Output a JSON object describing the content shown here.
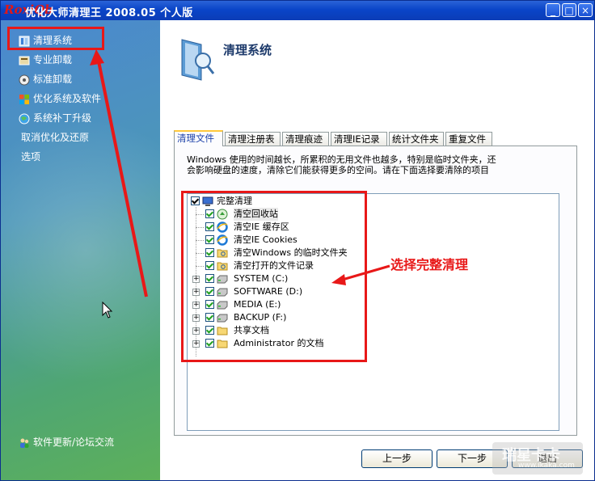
{
  "window": {
    "logo_text": "RoxiQb",
    "title": "优化大师清理王 2008.05 个人版",
    "min_label": "_",
    "max_label": "□",
    "close_label": "×"
  },
  "sidebar": {
    "items": [
      {
        "label": "清理系统",
        "icon": "broom-icon"
      },
      {
        "label": "专业卸载",
        "icon": "uninstall-icon"
      },
      {
        "label": "标准卸载",
        "icon": "cd-icon"
      },
      {
        "label": "优化系统及软件",
        "icon": "windows-flag-icon"
      },
      {
        "label": "系统补丁升级",
        "icon": "globe-icon"
      }
    ],
    "plain_items": [
      "取消优化及还原",
      "选项"
    ],
    "footer_label": "软件更新/论坛交流"
  },
  "main": {
    "title": "清理系统",
    "tabs": [
      "清理文件",
      "清理注册表",
      "清理痕迹",
      "清理IE记录",
      "统计文件夹",
      "重复文件"
    ],
    "description_line1": "Windows 使用的时间越长，所累积的无用文件也越多，特别是临时文件夹，还",
    "description_line2": "会影响硬盘的速度，清除它们能获得更多的空间。请在下面选择要清除的项目",
    "tree": {
      "root": "完整清理",
      "children": [
        {
          "label": "清空回收站",
          "icon": "recycle-bin-icon"
        },
        {
          "label": "清空IE 缓存区",
          "icon": "ie-icon"
        },
        {
          "label": "清空IE Cookies",
          "icon": "ie-icon"
        },
        {
          "label": "清空Windows 的临时文件夹",
          "icon": "folder-search-icon"
        },
        {
          "label": "清空打开的文件记录",
          "icon": "folder-search-icon"
        },
        {
          "label": "SYSTEM  (C:)",
          "icon": "drive-icon"
        },
        {
          "label": "SOFTWARE  (D:)",
          "icon": "drive-icon"
        },
        {
          "label": "MEDIA  (E:)",
          "icon": "drive-icon"
        },
        {
          "label": "BACKUP  (F:)",
          "icon": "drive-icon"
        },
        {
          "label": "共享文档",
          "icon": "folder-icon"
        },
        {
          "label": "Administrator 的文档",
          "icon": "folder-icon"
        }
      ]
    },
    "annotation": "选择完整清理",
    "buttons": {
      "prev": "上一步",
      "next": "下一步",
      "exit": "退出"
    }
  },
  "watermark": {
    "text": "瑞星卡卡",
    "url": "www.ikaka.com"
  },
  "colors": {
    "titlebar": "#0a45c8",
    "annotation_red": "#e81818",
    "sidebar_top": "#4b88cf",
    "sidebar_bottom": "#5db05a"
  }
}
